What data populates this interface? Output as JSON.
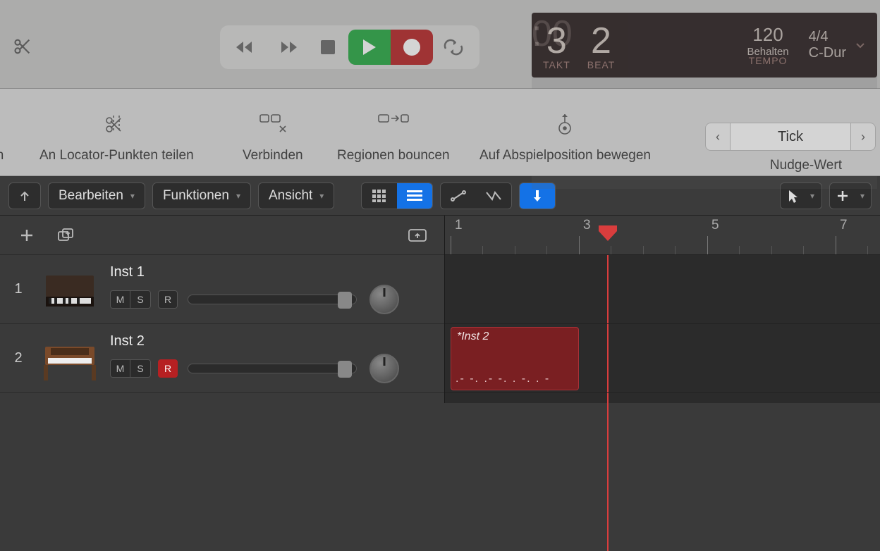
{
  "transport": {
    "lcd": {
      "bar_prefix": "00",
      "bar": "3",
      "beat": "2",
      "tempo_value": "120",
      "tempo_sub": "Behalten",
      "time_sig": "4/4",
      "key": "C-Dur",
      "labels": {
        "bar": "TAKT",
        "beat": "BEAT",
        "tempo": "TEMPO"
      }
    }
  },
  "sec_tools": {
    "cut_partial": "len",
    "split_locators": "An Locator-Punkten teilen",
    "merge": "Verbinden",
    "bounce": "Regionen bouncen",
    "move_playhead": "Auf Abspielposition bewegen"
  },
  "nudge": {
    "value": "Tick",
    "label": "Nudge-Wert"
  },
  "editor": {
    "menus": {
      "edit": "Bearbeiten",
      "functions": "Funktionen",
      "view": "Ansicht"
    }
  },
  "ruler": {
    "marks": [
      "1",
      "3",
      "5",
      "7"
    ]
  },
  "tracks": [
    {
      "num": "1",
      "name": "Inst 1",
      "armed": false
    },
    {
      "num": "2",
      "name": "Inst 2",
      "armed": true
    }
  ],
  "region": {
    "name": "*Inst 2"
  }
}
